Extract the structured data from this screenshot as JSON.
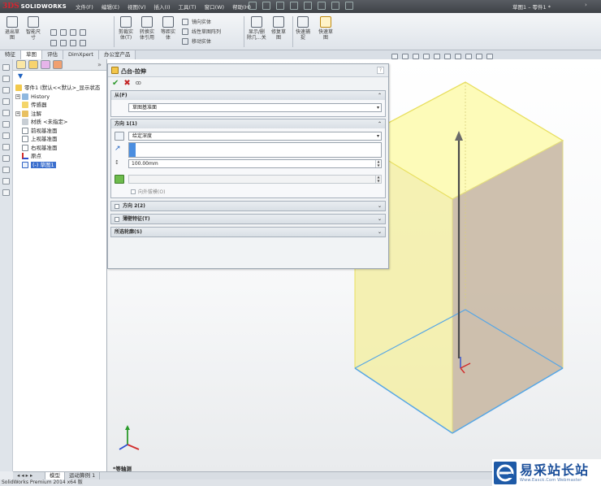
{
  "app": {
    "logo_ds": "3DS",
    "logo_name": "SOLIDWORKS"
  },
  "menu": [
    "文件(F)",
    "编辑(E)",
    "视图(V)",
    "插入(I)",
    "工具(T)",
    "窗口(W)",
    "帮助(H)"
  ],
  "document_title": "草图1 – 零件1 *",
  "ribbon": {
    "buttons": [
      {
        "label": "退出草\n图"
      },
      {
        "label": "智能尺\n寸"
      },
      {
        "label": "剪裁实\n体(T)"
      },
      {
        "label": "转换实\n体引用"
      },
      {
        "label": "等距实\n体"
      },
      {
        "label": "显示/删\n除几...关"
      },
      {
        "label": "修复草\n图"
      },
      {
        "label": "快速捕\n捉"
      },
      {
        "label": "快速草\n图"
      }
    ],
    "small_items": [
      "镜向实体",
      "线性草图阵列",
      "移动实体"
    ]
  },
  "tabs": [
    "特征",
    "草图",
    "评估",
    "DimXpert",
    "办公室产品"
  ],
  "tree": {
    "items": [
      {
        "label": "零件1  (默认<<默认>_显示状态",
        "level": 0
      },
      {
        "label": "History",
        "level": 1
      },
      {
        "label": "传感器",
        "level": 1
      },
      {
        "label": "注解",
        "level": 1
      },
      {
        "label": "材质 <未指定>",
        "level": 1
      },
      {
        "label": "前视基准面",
        "level": 1
      },
      {
        "label": "上视基准面",
        "level": 1
      },
      {
        "label": "右视基准面",
        "level": 1
      },
      {
        "label": "原点",
        "level": 1
      },
      {
        "label": "(-) 草图1",
        "level": 1
      }
    ]
  },
  "property_manager": {
    "title": "凸台-拉伸",
    "help": "?",
    "from": {
      "header": "从(F)",
      "value": "草图基准面"
    },
    "direction1": {
      "header": "方向 1(1)",
      "end_condition": "给定深度",
      "depth": "100.00mm",
      "draft_outward": "向外拔模(O)"
    },
    "direction2": {
      "header": "方向 2(2)"
    },
    "thin_feature": {
      "header": "薄壁特征(T)"
    },
    "selected_contours": {
      "header": "所选轮廓(S)"
    }
  },
  "view_label": "*等轴测",
  "bottom_tabs": [
    "模型",
    "运动算例 1"
  ],
  "statusbar": "SolidWorks Premium 2014 x64 版",
  "watermark": {
    "main": "易采站长站",
    "sub": "Www.Easck.Com Webmaster"
  },
  "colors": {
    "top_face": "#fdfbb9",
    "left_face": "#f3eea6",
    "right_face": "#c9b9a5",
    "edge_yellow": "#e8df60",
    "sketch_blue": "#55a6e6"
  }
}
